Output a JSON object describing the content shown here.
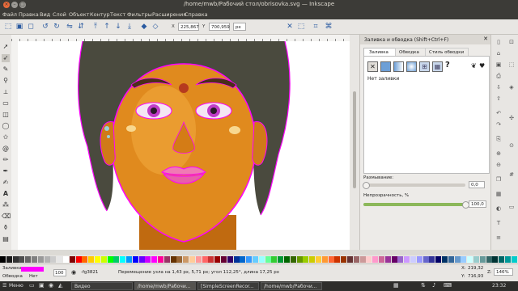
{
  "window": {
    "title": "/home/mwb/Рабочий стол/obrisovka.svg — Inkscape"
  },
  "menu": [
    "Файл",
    "Правка",
    "Вид",
    "Слой",
    "Объект",
    "Контур",
    "Текст",
    "Фильтры",
    "Расширения",
    "Справка"
  ],
  "toolbar": {
    "x_label": "X",
    "x_value": "225,867",
    "y_label": "Y",
    "y_value": "700,959",
    "unit": "px"
  },
  "fill_panel": {
    "title": "Заливка и обводка (Shift+Ctrl+F)",
    "tabs": [
      "Заливка",
      "Обводка",
      "Стиль обводки"
    ],
    "no_fill": "Нет заливки",
    "unknown_symbol": "?",
    "blur_label": "Размывание:",
    "blur_value": "0,0",
    "opacity_label": "Непрозрачность, %",
    "opacity_value": "100,0",
    "opacity_fraction": 1.0
  },
  "status": {
    "fill_label": "Заливка",
    "stroke_label": "Обводка",
    "none_label": "Нет",
    "fill_color": "#ff00ff",
    "layer_value": "100",
    "layer_name": "-fg3821",
    "message": "Перемещение узла на 1,43 px, 5,71 px; угол 112,25°, длина 17,25 px",
    "x_label": "X:",
    "x_coord": "219,32",
    "y_label": "Y:",
    "y_coord": "716,93",
    "zoom_label": "Z:",
    "zoom_value": "146%"
  },
  "taskbar": {
    "menu_label": "Меню",
    "tasks": [
      "Видео",
      "/home/mwb/Рабочи...",
      "[SimpleScreenRecor...",
      "/home/mwb/Рабочи..."
    ],
    "clock": "23:32"
  },
  "colors": {
    "accent": "#ff00ff",
    "skin": "#e08a1e",
    "hair": "#4a4a3e",
    "eye_ring": "#c03cc8"
  }
}
